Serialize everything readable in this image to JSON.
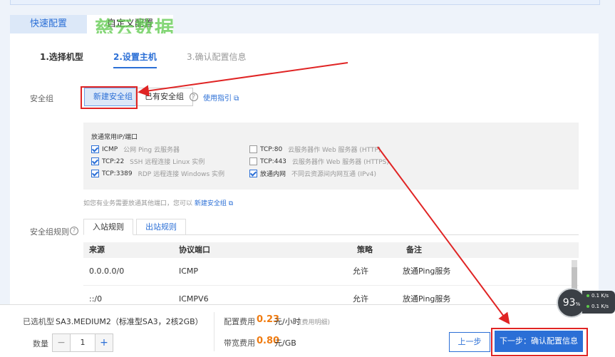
{
  "mode_tabs": [
    "快速配置",
    "自定义配置"
  ],
  "watermark": "慈云数据",
  "steps": [
    "1.选择机型",
    "2.设置主机",
    "3.确认配置信息"
  ],
  "security_group": {
    "label": "安全组",
    "new_button": "新建安全组",
    "existing_button": "已有安全组",
    "help": "?",
    "guide_link": "使用指引 ⧉"
  },
  "ports": {
    "title": "放通常用IP/端口",
    "items": [
      {
        "name": "ICMP",
        "desc": "公网 Ping 云服务器",
        "checked": true
      },
      {
        "name": "TCP:22",
        "desc": "SSH 远程连接 Linux 实例",
        "checked": true
      },
      {
        "name": "TCP:3389",
        "desc": "RDP 远程连接 Windows 实例",
        "checked": true
      },
      {
        "name": "TCP:80",
        "desc": "云服务器作 Web 服务器 (HTTP)",
        "checked": false
      },
      {
        "name": "TCP:443",
        "desc": "云服务器作 Web 服务器 (HTTPS)",
        "checked": false
      },
      {
        "name": "放通内网",
        "desc": "不同云资源间内网互通 (IPv4)",
        "checked": true
      }
    ]
  },
  "note": {
    "text": "如您有业务需要放通其他端口，您可以",
    "link": "新建安全组 ⧉"
  },
  "rules": {
    "label": "安全组规则",
    "tabs": [
      "入站规则",
      "出站规则"
    ],
    "columns": [
      "来源",
      "协议端口",
      "策略",
      "备注"
    ],
    "rows": [
      [
        "0.0.0.0/0",
        "ICMP",
        "允许",
        "放通Ping服务"
      ],
      [
        "::/0",
        "ICMPV6",
        "允许",
        "放通Ping服务"
      ]
    ]
  },
  "bottom": {
    "selected_label": "已选机型",
    "selected_value": "SA3.MEDIUM2（标准型SA3，2核2GB）",
    "qty_label": "数量",
    "qty": "1",
    "minus": "−",
    "plus": "+",
    "config_fee_label": "配置费用",
    "config_fee": "0.23",
    "config_fee_unit": "元/小时",
    "config_fee_sub": "(费用明细)",
    "bandwidth_fee_label": "带宽费用",
    "bandwidth_fee": "0.80",
    "bandwidth_fee_unit": "元/GB",
    "prev_button": "上一步",
    "next_button": "下一步：确认配置信息"
  },
  "widget": {
    "percent": "93",
    "percent_unit": "%",
    "up": "0.1",
    "up_unit": "K/s",
    "down": "0.1",
    "down_unit": "K/s"
  },
  "colors": {
    "accent": "#2b6fd6",
    "annotation": "#e02424",
    "price": "#f07b10"
  }
}
